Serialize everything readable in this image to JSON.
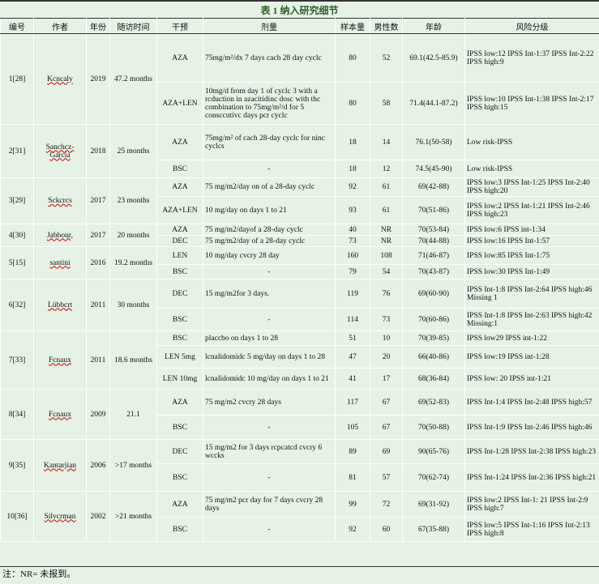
{
  "title": "表 1 纳入研究细节",
  "headers": [
    "编号",
    "作者",
    "年份",
    "随访时间",
    "干预",
    "剂量",
    "样本量",
    "男性数",
    "年龄",
    "风险分级"
  ],
  "rows": [
    {
      "id": "1[28]",
      "author": "Kcncaly",
      "year": "2019",
      "followup": "47.2 months",
      "arms": [
        {
          "intervention": "AZA",
          "dose": "75mg/m²/dx 7 days cach 28 day cyclc",
          "n": "80",
          "male": "52",
          "age": "69.1(42.5-85.9)",
          "risk": "IPSS low:12 IPSS Int-1:37 IPSS Int-2:22 IPSS high:9"
        },
        {
          "intervention": "AZA+LEN",
          "dose": "10mg/d from day 1 of cyclc 3 with a rcduction in azacitidinc dosc with thc combination to 75mg/m²/d for 5 consccutivc days pcr cyclc",
          "n": "80",
          "male": "58",
          "age": "71.4(44.1-87.2)",
          "risk": "IPSS low:10 IPSS Int-1:38 IPSS Int-2:17 IPSS high:15"
        }
      ]
    },
    {
      "id": "2[31]",
      "author": "Sanchcz-Garcia",
      "year": "2018",
      "followup": "25 months",
      "arms": [
        {
          "intervention": "AZA",
          "dose": "75mg/m² of cach 28-day cyclc for ninc cyclcs",
          "n": "18",
          "male": "14",
          "age": "76.1(50-58)",
          "risk": "Low risk-IPSS"
        },
        {
          "intervention": "BSC",
          "dose": "-",
          "n": "18",
          "male": "12",
          "age": "74.5(45-90)",
          "risk": "Low risk-IPSS"
        }
      ]
    },
    {
      "id": "3[29]",
      "author": "Sckcrcs",
      "year": "2017",
      "followup": "23 months",
      "arms": [
        {
          "intervention": "AZA",
          "dose": "75 mg/m2/day on of a 28-day cyclc",
          "n": "92",
          "male": "61",
          "age": "69(42-88)",
          "risk": "IPSS low:3 IPSS Int-1:25 IPSS Int-2:40 IPSS high:20"
        },
        {
          "intervention": "AZA+LEN",
          "dose": "10 mg/day on days 1 to 21",
          "n": "93",
          "male": "61",
          "age": "70(51-86)",
          "risk": "IPSS low:2 IPSS Int-1:21 IPSS Int-2:46 IPSS high:23"
        }
      ]
    },
    {
      "id": "4[30]",
      "author": "Jabbour,",
      "year": "2017",
      "followup": "20 months",
      "arms": [
        {
          "intervention": "AZA",
          "dose": "75 mg/m2/dayof a 28-day cyclc",
          "n": "40",
          "male": "NR",
          "age": "70(53-84)",
          "risk": "IPSS low:6 IPSS int-1:34"
        },
        {
          "intervention": "DEC",
          "dose": "75 mg/m2/day of a 28-day cyclc",
          "n": "73",
          "male": "NR",
          "age": "70(44-88)",
          "risk": "IPSS low:16 IPSS Int-1:57"
        }
      ]
    },
    {
      "id": "5[15]",
      "author": "santini",
      "year": "2016",
      "followup": "19.2 months",
      "arms": [
        {
          "intervention": "LEN",
          "dose": "10 mg/day cvcry 28 day",
          "n": "160",
          "male": "108",
          "age": "71(46-87)",
          "risk": "IPSS low:85 IPSS Int-1:75"
        },
        {
          "intervention": "BSC",
          "dose": "-",
          "n": "79",
          "male": "54",
          "age": "70(43-87)",
          "risk": "IPSS low:30 IPSS Int-1:49"
        }
      ]
    },
    {
      "id": "6[32]",
      "author": "Lübbcrt",
      "year": "2011",
      "followup": "30 months",
      "arms": [
        {
          "intervention": "DEC",
          "dose": "15 mg/m2for 3 days.",
          "n": "119",
          "male": "76",
          "age": "69(60-90)",
          "risk": "IPSS Int-1:8 IPSS Int-2:64 IPSS high:46 Missing 1"
        },
        {
          "intervention": "BSC",
          "dose": "-",
          "n": "114",
          "male": "73",
          "age": "70(60-86)",
          "risk": "IPSS Int-1:8 IPSS Int-2:63 IPSS high:42 Missing:1"
        }
      ]
    },
    {
      "id": "7[33]",
      "author": "Fcnaux",
      "year": "2011",
      "followup": "18.6 months",
      "arms": [
        {
          "intervention": "BSC",
          "dose": "placcbo on days 1 to 28",
          "n": "51",
          "male": "10",
          "age": "70(39-85)",
          "risk": "IPSS low29 IPSS int-1:22"
        },
        {
          "intervention": "LEN 5mg",
          "dose": "lcnalidomidc 5 mg/day on days 1 to 28",
          "n": "47",
          "male": "20",
          "age": "66(40-86)",
          "risk": "IPSS low:19 IPSS int-1:28"
        },
        {
          "intervention": "LEN 10mg",
          "dose": "lcnalidomidc 10 mg/day on days 1 to 21",
          "n": "41",
          "male": "17",
          "age": "68(36-84)",
          "risk": "IPSS low: 20 IPSS int-1:21"
        }
      ]
    },
    {
      "id": "8[34]",
      "author": "Fcnaux",
      "year": "2009",
      "followup": "21.1",
      "arms": [
        {
          "intervention": "AZA",
          "dose": "75 mg/m2 cvcry 28 days",
          "n": "117",
          "male": "67",
          "age": "69(52-83)",
          "risk": "IPSS Int-1:4 IPSS Int-2:48 IPSS high:57"
        },
        {
          "intervention": "BSC",
          "dose": "-",
          "n": "105",
          "male": "67",
          "age": "70(50-88)",
          "risk": "IPSS Int-1:9 IPSS Int-2:46 IPSS high:46"
        }
      ]
    },
    {
      "id": "9[35]",
      "author": "Kantarjian",
      "year": "2006",
      "followup": ">17 months",
      "arms": [
        {
          "intervention": "DEC",
          "dose": "15 mg/m2 for 3 days rcpcatcd cvcry 6 wccks",
          "n": "89",
          "male": "69",
          "age": "90(65-76)",
          "risk": "IPSS Int-1:28 IPSS Int-2:38 IPSS high:23"
        },
        {
          "intervention": "BSC",
          "dose": "-",
          "n": "81",
          "male": "57",
          "age": "70(62-74)",
          "risk": "IPSS Int-1:24 IPSS Int-2:36 IPSS high:21"
        }
      ]
    },
    {
      "id": "10[36]",
      "author": "Silvcrman",
      "year": "2002",
      "followup": ">21 months",
      "arms": [
        {
          "intervention": "AZA",
          "dose": "75 mg/m2 pcr day for 7 days cvcry 28 days",
          "n": "99",
          "male": "72",
          "age": "69(31-92)",
          "risk": "IPSS low:2 IPSS Int-1: 21 IPSS Int-2:9 IPSS high:7"
        },
        {
          "intervention": "BSC",
          "dose": "-",
          "n": "92",
          "male": "60",
          "age": "67(35-88)",
          "risk": "IPSS low:5 IPSS Int-1:16 IPSS Int-2:13 IPSS high:8"
        }
      ]
    }
  ],
  "note": "注：NR= 未报到。"
}
